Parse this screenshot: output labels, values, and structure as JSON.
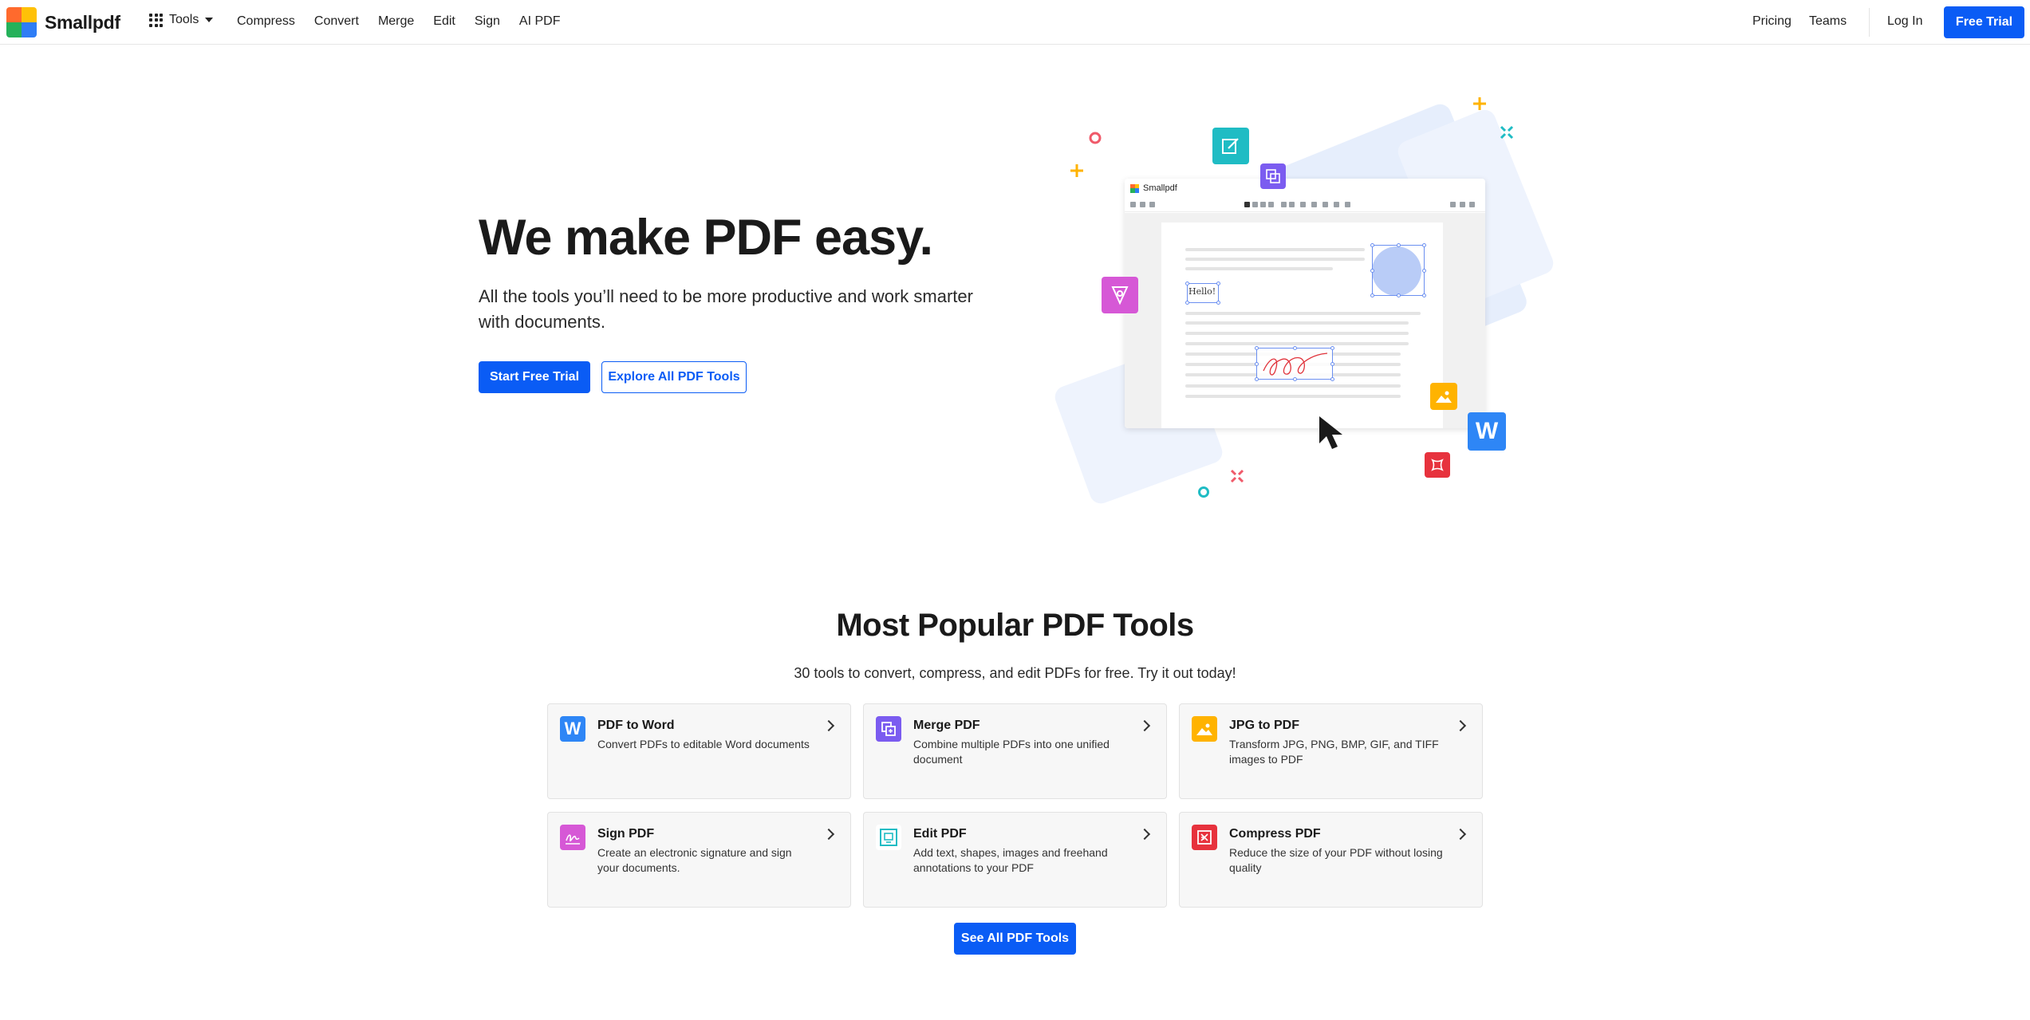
{
  "brand": {
    "name": "Smallpdf"
  },
  "nav": {
    "tools_label": "Tools",
    "links": [
      "Compress",
      "Convert",
      "Merge",
      "Edit",
      "Sign",
      "AI PDF"
    ],
    "pricing": "Pricing",
    "teams": "Teams",
    "login": "Log In",
    "free_trial": "Free Trial"
  },
  "hero": {
    "title": "We make PDF easy.",
    "subtitle": "All the tools you’ll need to be more productive and work smarter with documents.",
    "primary_cta": "Start Free Trial",
    "secondary_cta": "Explore All PDF Tools",
    "illustration": {
      "app_title": "Smallpdf",
      "sample_text": "Hello!"
    }
  },
  "popular": {
    "title": "Most Popular PDF Tools",
    "subtitle": "30 tools to convert, compress, and edit PDFs for free. Try it out today!",
    "tools": [
      {
        "title": "PDF to Word",
        "desc": "Convert PDFs to editable Word documents",
        "icon": "word-icon",
        "color": "#2e86f6"
      },
      {
        "title": "Merge PDF",
        "desc": "Combine multiple PDFs into one unified document",
        "icon": "merge-icon",
        "color": "#7b5cf0"
      },
      {
        "title": "JPG to PDF",
        "desc": "Transform JPG, PNG, BMP, GIF, and TIFF images to PDF",
        "icon": "image-icon",
        "color": "#ffb300"
      },
      {
        "title": "Sign PDF",
        "desc": "Create an electronic signature and sign your documents.",
        "icon": "signature-icon",
        "color": "#d658d6"
      },
      {
        "title": "Edit PDF",
        "desc": "Add text, shapes, images and freehand annotations to your PDF",
        "icon": "edit-icon",
        "color": "#1fbcc4"
      },
      {
        "title": "Compress PDF",
        "desc": "Reduce the size of your PDF without losing quality",
        "icon": "compress-icon",
        "color": "#e7323d"
      }
    ],
    "see_all": "See All PDF Tools"
  },
  "colors": {
    "accent": "#0a5cf5",
    "card_bg": "#f7f7f7"
  }
}
